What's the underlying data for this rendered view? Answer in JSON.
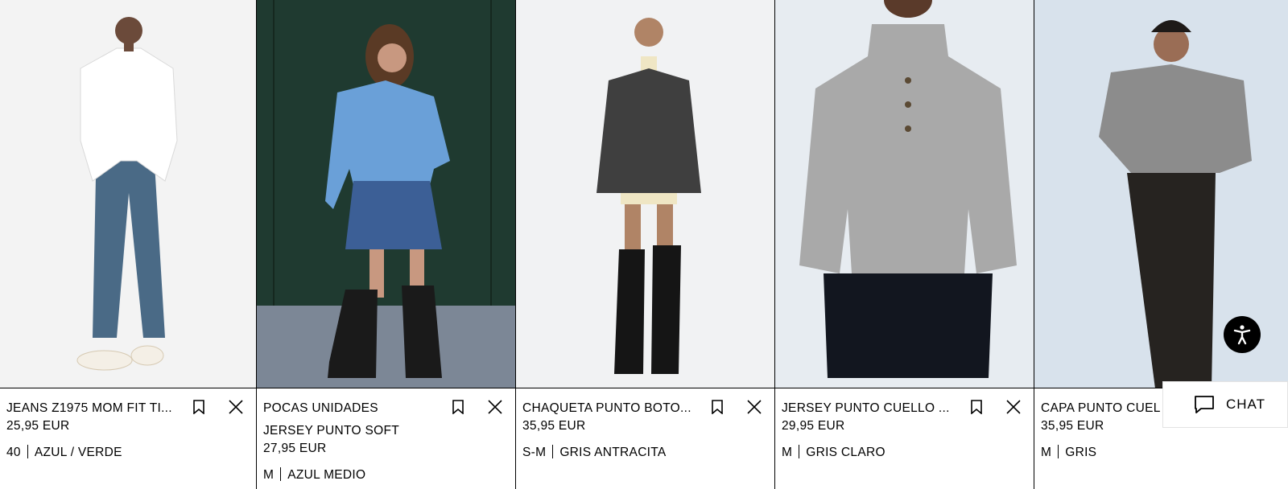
{
  "products": [
    {
      "tag": "",
      "name": "JEANS Z1975 MOM FIT TI...",
      "price": "25,95 EUR",
      "size": "40",
      "color": "AZUL / VERDE",
      "bg": "#f2f2f2"
    },
    {
      "tag": "POCAS UNIDADES",
      "name": "JERSEY PUNTO SOFT",
      "price": "27,95 EUR",
      "size": "M",
      "color": "AZUL MEDIO",
      "bg": "#1f3a30"
    },
    {
      "tag": "",
      "name": "CHAQUETA PUNTO BOTO...",
      "price": "35,95 EUR",
      "size": "S-M",
      "color": "GRIS ANTRACITA",
      "bg": "#eef0f2"
    },
    {
      "tag": "",
      "name": "JERSEY PUNTO CUELLO ...",
      "price": "29,95 EUR",
      "size": "M",
      "color": "GRIS CLARO",
      "bg": "#e6ebf0"
    },
    {
      "tag": "",
      "name": "CAPA PUNTO CUEL",
      "price": "35,95 EUR",
      "size": "M",
      "color": "GRIS",
      "bg": "#d9e3ec"
    }
  ],
  "chat": {
    "label": "CHAT"
  },
  "icons": {
    "save": "bookmark-icon",
    "remove": "close-icon",
    "accessibility": "accessibility-icon",
    "chat": "chat-bubble-icon"
  }
}
